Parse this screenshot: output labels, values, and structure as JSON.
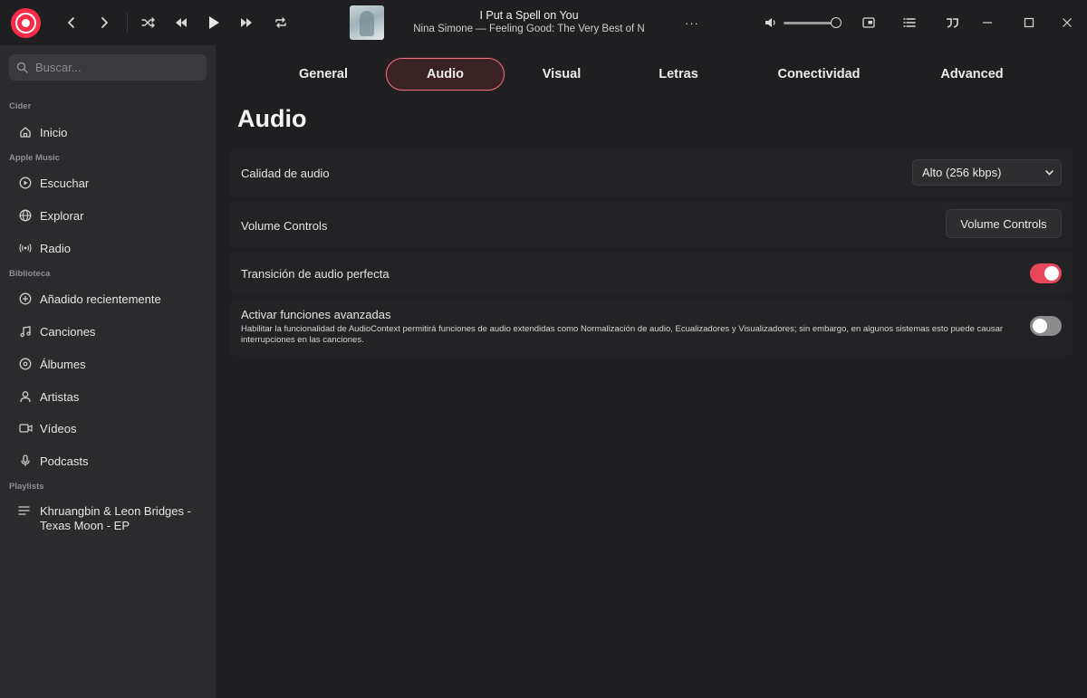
{
  "player": {
    "track_title": "I Put a Spell on You",
    "track_subtitle": "Nina Simone — Feeling Good: The Very Best of N",
    "more_label": "···"
  },
  "search": {
    "placeholder": "Buscar..."
  },
  "sidebar": {
    "sections": {
      "cider": "Cider",
      "apple_music": "Apple Music",
      "library": "Biblioteca",
      "playlists": "Playlists"
    },
    "items": [
      {
        "label": "Inicio",
        "icon": "home-icon"
      },
      {
        "label": "Escuchar",
        "icon": "play-circle-icon"
      },
      {
        "label": "Explorar",
        "icon": "globe-icon"
      },
      {
        "label": "Radio",
        "icon": "radio-icon"
      },
      {
        "label": "Añadido recientemente",
        "icon": "plus-circle-icon"
      },
      {
        "label": "Canciones",
        "icon": "music-note-icon"
      },
      {
        "label": "Álbumes",
        "icon": "album-icon"
      },
      {
        "label": "Artistas",
        "icon": "person-icon"
      },
      {
        "label": "Vídeos",
        "icon": "video-icon"
      },
      {
        "label": "Podcasts",
        "icon": "microphone-icon"
      }
    ],
    "playlist": {
      "line1": "Khruangbin & Leon Bridges -",
      "line2": "Texas Moon - EP",
      "icon": "list-icon"
    }
  },
  "tabs": [
    "General",
    "Audio",
    "Visual",
    "Letras",
    "Conectividad",
    "Advanced"
  ],
  "active_tab": "Audio",
  "page_title": "Audio",
  "settings": {
    "quality": {
      "label": "Calidad de audio",
      "value": "Alto (256 kbps)"
    },
    "volume": {
      "label": "Volume Controls",
      "button": "Volume Controls"
    },
    "gapless": {
      "label": "Transición de audio perfecta",
      "enabled": true
    },
    "advanced": {
      "label": "Activar funciones avanzadas",
      "description": "Habilitar la funcionalidad de AudioContext permitirá funciones de audio extendidas como Normalización de audio, Ecualizadores y Visualizadores; sin embargo, en algunos sistemas esto puede causar interrupciones en las canciones.",
      "enabled": false
    }
  },
  "colors": {
    "accent": "#fa2d48",
    "toggle_on": "#e8465a",
    "toggle_off": "#8c8c8f",
    "sidebar_bg": "#2b2b2d",
    "main_bg": "#1f1f21"
  }
}
